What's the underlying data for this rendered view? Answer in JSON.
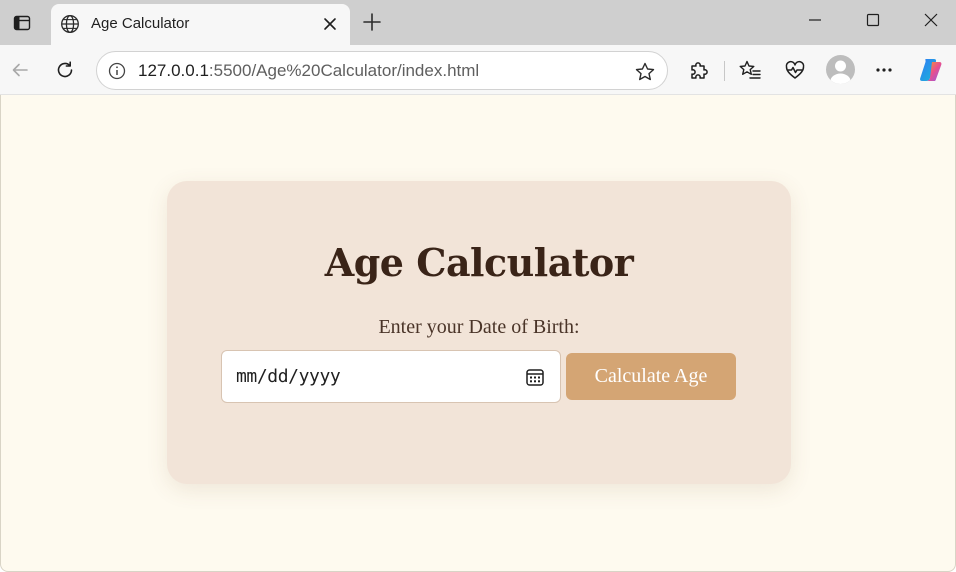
{
  "browser": {
    "tab": {
      "title": "Age Calculator"
    },
    "address_bar": {
      "host": "127.0.0.1",
      "rest": ":5500/Age%20Calculator/index.html"
    },
    "icons": {
      "sidebar": "tab-actions-icon",
      "favicon": "globe-icon",
      "tab_close": "close-icon",
      "new_tab": "plus-icon",
      "minimize": "minimize-icon",
      "maximize": "maximize-icon",
      "close_window": "close-icon",
      "back": "back-arrow-icon",
      "refresh": "refresh-icon",
      "site_info": "info-icon",
      "favorite": "star-icon",
      "extensions": "puzzle-icon",
      "favorites": "favorites-list-icon",
      "performance": "heartbeat-icon",
      "profile": "avatar-icon",
      "more": "more-dots-icon",
      "copilot": "copilot-icon"
    }
  },
  "page": {
    "title": "Age Calculator",
    "dob_label": "Enter your Date of Birth:",
    "date_input": {
      "placeholder": "mm/dd/yyyy"
    },
    "calculate_button": "Calculate Age"
  },
  "colors": {
    "page_background": "#fefaef",
    "card_background": "#f2e4d8",
    "title_color": "#3a2418",
    "button_background": "#d4a574",
    "button_text": "#ffffff"
  }
}
